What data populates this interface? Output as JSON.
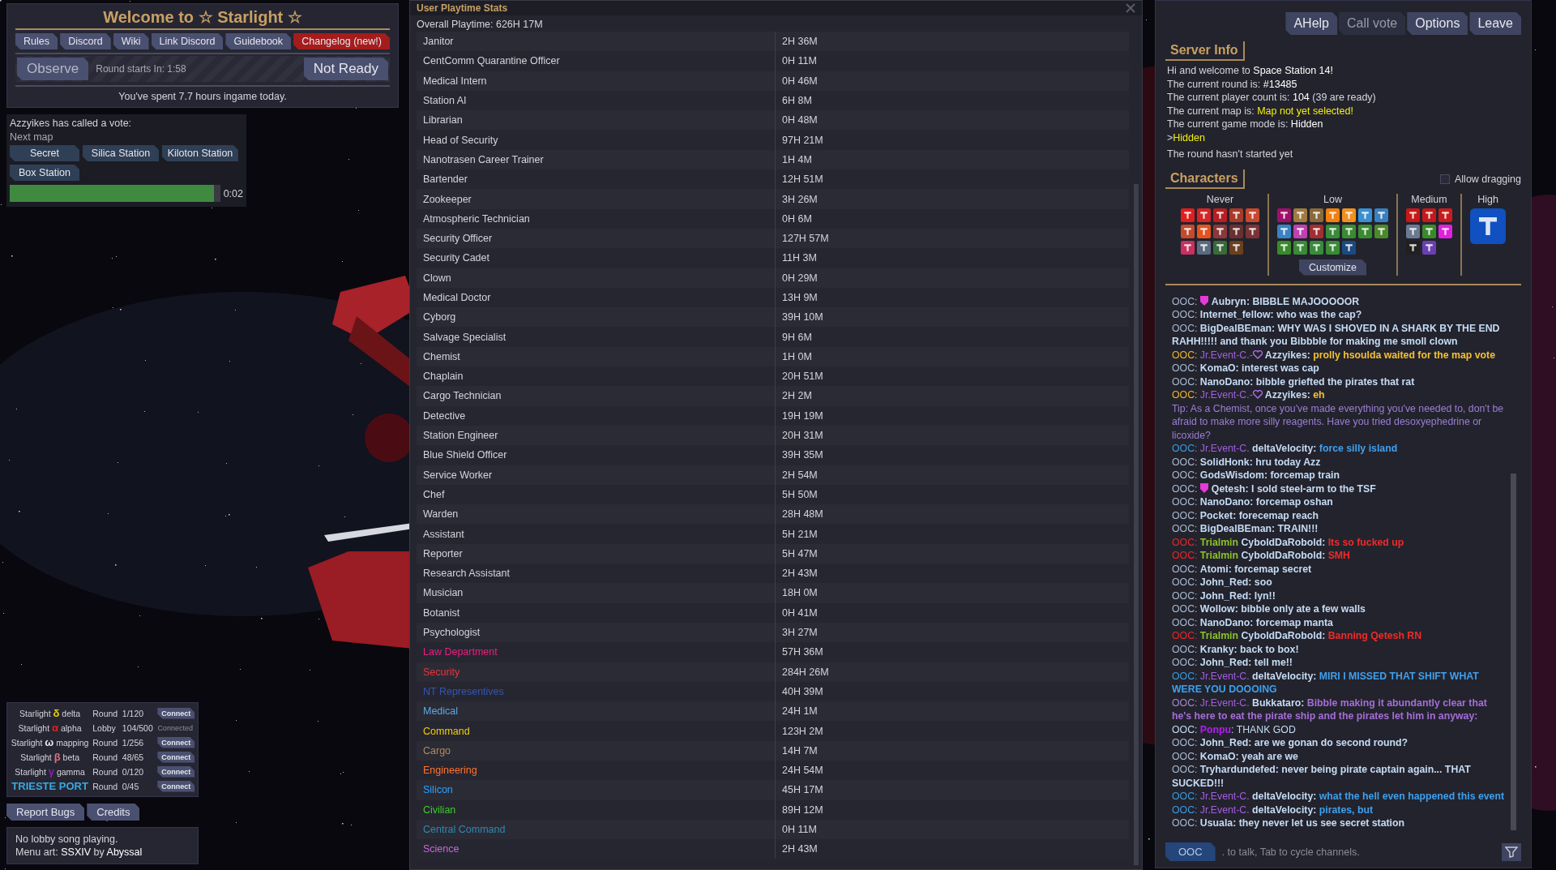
{
  "lobby": {
    "title": "Welcome to ☆ Starlight ☆",
    "links": [
      {
        "label": "Rules",
        "highlight": false
      },
      {
        "label": "Discord",
        "highlight": false
      },
      {
        "label": "Wiki",
        "highlight": false
      },
      {
        "label": "Link Discord",
        "highlight": false
      },
      {
        "label": "Guidebook",
        "highlight": false
      },
      {
        "label": "Changelog (new!)",
        "highlight": true
      }
    ],
    "observe": "Observe",
    "countdown": "Round starts In: 1:58",
    "ready": "Not Ready",
    "playtime_note": "You've spent 7.7 hours ingame today."
  },
  "vote": {
    "title": "Azzyikes has called a vote:",
    "subtitle": "Next map",
    "options": [
      "Secret",
      "Silica Station",
      "Kiloton Station",
      "Box Station"
    ],
    "level": 0.97,
    "timer": "0:02"
  },
  "servers": [
    {
      "name": [
        {
          "text": "Starlight "
        },
        {
          "text": "δ",
          "color": "#e6d200"
        },
        {
          "text": " delta"
        }
      ],
      "status": "Round",
      "players": "1/120",
      "action": "Connect",
      "connected": false
    },
    {
      "name": [
        {
          "text": "Starlight "
        },
        {
          "text": "α",
          "color": "#e02020"
        },
        {
          "text": " alpha"
        }
      ],
      "status": "Lobby",
      "players": "104/500",
      "action": "Connected",
      "connected": true
    },
    {
      "name": [
        {
          "text": "Starlight "
        },
        {
          "text": "ω",
          "color": "#e8e8f0"
        },
        {
          "text": " mapping"
        }
      ],
      "status": "Round",
      "players": "1/256",
      "action": "Connect",
      "connected": false
    },
    {
      "name": [
        {
          "text": "Starlight "
        },
        {
          "text": "β",
          "color": "#e07080"
        },
        {
          "text": " beta"
        }
      ],
      "status": "Round",
      "players": "48/65",
      "action": "Connect",
      "connected": false
    },
    {
      "name": [
        {
          "text": "Starlight "
        },
        {
          "text": "γ",
          "color": "#8a20b0"
        },
        {
          "text": " gamma"
        }
      ],
      "status": "Round",
      "players": "0/120",
      "action": "Connect",
      "connected": false
    },
    {
      "name": [
        {
          "text": "TRIESTE PORT",
          "color": "#3aa8e0"
        }
      ],
      "status": "Round",
      "players": "0/45",
      "action": "Connect",
      "connected": false
    }
  ],
  "bottom_buttons": [
    "Report Bugs",
    "Credits"
  ],
  "lobby_info": [
    [
      {
        "text": "No lobby song playing."
      }
    ],
    [
      {
        "text": "Menu art: "
      },
      {
        "text": "SSXIV",
        "color": "#ffffff"
      },
      {
        "text": " by "
      },
      {
        "text": "Abyssal",
        "color": "#ffffff"
      }
    ]
  ],
  "playtime": {
    "title": "User Playtime Stats",
    "overall": "Overall Playtime: 626H 17M",
    "rows": [
      {
        "job": "Janitor",
        "time": "2H 36M"
      },
      {
        "job": "CentComm Quarantine Officer",
        "time": "0H 11M"
      },
      {
        "job": "Medical Intern",
        "time": "0H 46M"
      },
      {
        "job": "Station AI",
        "time": "6H 8M"
      },
      {
        "job": "Librarian",
        "time": "0H 48M"
      },
      {
        "job": "Head of Security",
        "time": "97H 21M"
      },
      {
        "job": "Nanotrasen Career Trainer",
        "time": "1H 4M"
      },
      {
        "job": "Bartender",
        "time": "12H 51M"
      },
      {
        "job": "Zookeeper",
        "time": "3H 26M"
      },
      {
        "job": "Atmospheric Technician",
        "time": "0H 6M"
      },
      {
        "job": "Security Officer",
        "time": "127H 57M"
      },
      {
        "job": "Security Cadet",
        "time": "11H 3M"
      },
      {
        "job": "Clown",
        "time": "0H 29M"
      },
      {
        "job": "Medical Doctor",
        "time": "13H 9M"
      },
      {
        "job": "Cyborg",
        "time": "39H 10M"
      },
      {
        "job": "Salvage Specialist",
        "time": "9H 6M"
      },
      {
        "job": "Chemist",
        "time": "1H 0M"
      },
      {
        "job": "Chaplain",
        "time": "20H 51M"
      },
      {
        "job": "Cargo Technician",
        "time": "2H 2M"
      },
      {
        "job": "Detective",
        "time": "19H 19M"
      },
      {
        "job": "Station Engineer",
        "time": "20H 31M"
      },
      {
        "job": "Blue Shield Officer",
        "time": "39H 35M"
      },
      {
        "job": "Service Worker",
        "time": "2H 54M"
      },
      {
        "job": "Chef",
        "time": "5H 50M"
      },
      {
        "job": "Warden",
        "time": "28H 48M"
      },
      {
        "job": "Assistant",
        "time": "5H 21M"
      },
      {
        "job": "Reporter",
        "time": "5H 47M"
      },
      {
        "job": "Research Assistant",
        "time": "2H 43M"
      },
      {
        "job": "Musician",
        "time": "18H 0M"
      },
      {
        "job": "Botanist",
        "time": "0H 41M"
      },
      {
        "job": "Psychologist",
        "time": "3H 27M"
      },
      {
        "job": "Law Department",
        "time": "57H 36M",
        "color": "#e8207e"
      },
      {
        "job": "Security",
        "time": "284H 26M",
        "color": "#e8353a"
      },
      {
        "job": "NT Representives",
        "time": "40H 39M",
        "color": "#3555b4"
      },
      {
        "job": "Medical",
        "time": "24H 1M",
        "color": "#5aaae8"
      },
      {
        "job": "Command",
        "time": "123H 2M",
        "color": "#f0d000"
      },
      {
        "job": "Cargo",
        "time": "14H 7M",
        "color": "#b08a5c"
      },
      {
        "job": "Engineering",
        "time": "24H 54M",
        "color": "#ff7430"
      },
      {
        "job": "Silicon",
        "time": "45H 17M",
        "color": "#2aa2ff"
      },
      {
        "job": "Civilian",
        "time": "89H 12M",
        "color": "#3ccc2a"
      },
      {
        "job": "Central Command",
        "time": "0H 11M",
        "color": "#3088b0"
      },
      {
        "job": "Science",
        "time": "2H 43M",
        "color": "#c46ad6"
      }
    ]
  },
  "menu": {
    "buttons": [
      {
        "label": "AHelp",
        "disabled": false
      },
      {
        "label": "Call vote",
        "disabled": true
      },
      {
        "label": "Options",
        "disabled": false
      },
      {
        "label": "Leave",
        "disabled": false
      }
    ]
  },
  "server_info": {
    "heading": "Server Info",
    "lines": [
      [
        {
          "text": "Hi and welcome to "
        },
        {
          "text": "Space Station 14!",
          "color": "#ffffff"
        }
      ],
      [
        {
          "text": "The current round is: "
        },
        {
          "text": "#13485",
          "color": "#ffffff"
        }
      ],
      [
        {
          "text": "The current player count is: "
        },
        {
          "text": "104",
          "color": "#ffffff"
        },
        {
          "text": " (39 are ready)"
        }
      ],
      [
        {
          "text": "The current map is: "
        },
        {
          "text": "Map not yet selected!",
          "color": "#f2ee10"
        }
      ],
      [
        {
          "text": "The current game mode is: "
        },
        {
          "text": "Hidden",
          "color": "#ffffff"
        }
      ],
      [
        {
          "text": ">"
        },
        {
          "text": "Hidden",
          "color": "#f2ee10"
        }
      ],
      [
        {
          "text": "The round hasn't started yet"
        }
      ]
    ]
  },
  "characters": {
    "heading": "Characters",
    "allow_dragging": {
      "label": "Allow dragging",
      "checked": false
    },
    "customize": "Customize",
    "groups": [
      {
        "label": "Never",
        "jobs": [
          {
            "color": "#e01e1e"
          },
          {
            "color": "#d42626"
          },
          {
            "color": "#b81e22"
          },
          {
            "color": "#a83a28"
          },
          {
            "color": "#c8482e"
          },
          {
            "color": "#c44a2c"
          },
          {
            "color": "#e4531c"
          },
          {
            "color": "#8a3838"
          },
          {
            "color": "#6a3030"
          },
          {
            "color": "#7a3434"
          },
          {
            "color": "#c83060"
          },
          {
            "color": "#5a6a80"
          },
          {
            "color": "#3a6a3a"
          },
          {
            "color": "#6a4020"
          }
        ]
      },
      {
        "label": "Low",
        "jobs": [
          {
            "color": "#a0106a"
          },
          {
            "color": "#a07a40"
          },
          {
            "color": "#8a6a3a"
          },
          {
            "color": "#f08010"
          },
          {
            "color": "#f09020"
          },
          {
            "color": "#3a90d0"
          },
          {
            "color": "#3a80c0"
          },
          {
            "color": "#3a82c4"
          },
          {
            "color": "#c040b0"
          },
          {
            "color": "#a03030"
          },
          {
            "color": "#3a8a3a"
          },
          {
            "color": "#3a8a34"
          },
          {
            "color": "#3a8a30"
          },
          {
            "color": "#4a8a2a"
          },
          {
            "color": "#3a8a2a"
          },
          {
            "color": "#3a8a38"
          },
          {
            "color": "#3a8a3c"
          },
          {
            "color": "#3a8a36"
          },
          {
            "color": "#1a4a80"
          }
        ]
      },
      {
        "label": "Medium",
        "jobs": [
          {
            "color": "#c81818"
          },
          {
            "color": "#c41a1a"
          },
          {
            "color": "#c81c1c"
          },
          {
            "color": "#6a7a90"
          },
          {
            "color": "#3a8a2a"
          },
          {
            "color": "#e020e0"
          },
          {
            "color": "#202020"
          },
          {
            "color": "#6a40b0"
          }
        ]
      },
      {
        "label": "High",
        "jobs": [
          {
            "color": "#1050c0"
          }
        ]
      }
    ]
  },
  "chat": {
    "channel": "OOC",
    "placeholder": ". to talk, Tab to cycle channels.",
    "messages": [
      {
        "kind": "shield",
        "lead": [
          {
            "text": "OOC: ",
            "color": "#a9bad0"
          }
        ],
        "body": [
          {
            "text": "**Aubryn: BIBBLE MAJOOOOOR**",
            "color": "#c5dcf4"
          }
        ]
      },
      {
        "body": [
          {
            "text": "OOC: ",
            "color": "#a9bad0"
          },
          {
            "text": "**Internet_fellow: who was the cap?**",
            "color": "#c5dcf4"
          }
        ]
      },
      {
        "body": [
          {
            "text": "OOC: ",
            "color": "#a9bad0"
          },
          {
            "text": "**BigDealBEman: WHY WAS I SHOVED IN A SHARK BY THE END RAHH!!!!! and thank you Bibbble for making me smoll clown**",
            "color": "#c5dcf4"
          }
        ]
      },
      {
        "kind": "heart",
        "lead": [
          {
            "text": "OOC: ",
            "color": "#f0b428"
          },
          {
            "text": "Jr.Event-C.-",
            "color": "#a35ee0"
          }
        ],
        "body": [
          {
            "text": "**Azzyikes:** ",
            "color": "#c5dcf4"
          },
          {
            "text": "**prolly hsoulda waited for the map vote**",
            "color": "#f5c030"
          }
        ]
      },
      {
        "body": [
          {
            "text": "OOC: ",
            "color": "#a9bad0"
          },
          {
            "text": "**KomaO: interest was cap**",
            "color": "#c5dcf4"
          }
        ]
      },
      {
        "body": [
          {
            "text": "OOC: ",
            "color": "#a9bad0"
          },
          {
            "text": "**NanoDano: bibble griefted the pirates that rat**",
            "color": "#c5dcf4"
          }
        ]
      },
      {
        "kind": "heart",
        "lead": [
          {
            "text": "OOC: ",
            "color": "#f0b428"
          },
          {
            "text": "Jr.Event-C.-",
            "color": "#a35ee0"
          }
        ],
        "body": [
          {
            "text": "**Azzyikes:** ",
            "color": "#c5dcf4"
          },
          {
            "text": "**eh**",
            "color": "#f5c030"
          }
        ]
      },
      {
        "body": [
          {
            "text": "Tip: As a Chemist, once you've made everything you've needed to, don't be afraid to make more silly reagents. Have you tried desoxyephedrine or licoxide?",
            "color": "#9a7fd2"
          }
        ]
      },
      {
        "body": [
          {
            "text": "OOC: ",
            "color": "#3a9be0"
          },
          {
            "text": "Jr.Event-C.",
            "color": "#a35ee0"
          },
          {
            "text": " **deltaVelocity:** ",
            "color": "#c5dcf4"
          },
          {
            "text": "**force silly island**",
            "color": "#3ea0ee"
          }
        ]
      },
      {
        "body": [
          {
            "text": "OOC: ",
            "color": "#a9bad0"
          },
          {
            "text": "**SolidHonk: hru today Azz**",
            "color": "#c5dcf4"
          }
        ]
      },
      {
        "body": [
          {
            "text": "OOC: ",
            "color": "#a9bad0"
          },
          {
            "text": "**GodsWisdom: forcemap train**",
            "color": "#c5dcf4"
          }
        ]
      },
      {
        "kind": "shield",
        "lead": [
          {
            "text": "OOC: ",
            "color": "#a9bad0"
          }
        ],
        "body": [
          {
            "text": "**Qetesh: I sold steel-arm to the TSF**",
            "color": "#c5dcf4"
          }
        ]
      },
      {
        "body": [
          {
            "text": "OOC: ",
            "color": "#a9bad0"
          },
          {
            "text": "**NanoDano: forcemap oshan**",
            "color": "#c5dcf4"
          }
        ]
      },
      {
        "body": [
          {
            "text": "OOC: ",
            "color": "#a9bad0"
          },
          {
            "text": "**Pocket: forecemap reach**",
            "color": "#c5dcf4"
          }
        ]
      },
      {
        "body": [
          {
            "text": "OOC: ",
            "color": "#a9bad0"
          },
          {
            "text": "**BigDealBEman: TRAIN!!!**",
            "color": "#c5dcf4"
          }
        ]
      },
      {
        "body": [
          {
            "text": "OOC: ",
            "color": "#e82828"
          },
          {
            "text": "**Trialmin**",
            "color": "#8cc22a"
          },
          {
            "text": " **CyboldDaRobold:** ",
            "color": "#c5dcf4"
          },
          {
            "text": "**Its so fucked up**",
            "color": "#f02a2a"
          }
        ]
      },
      {
        "body": [
          {
            "text": "OOC: ",
            "color": "#e82828"
          },
          {
            "text": "**Trialmin**",
            "color": "#8cc22a"
          },
          {
            "text": " **CyboldDaRobold:** ",
            "color": "#c5dcf4"
          },
          {
            "text": "**SMH**",
            "color": "#f02a2a"
          }
        ]
      },
      {
        "body": [
          {
            "text": "OOC: ",
            "color": "#a9bad0"
          },
          {
            "text": "**Atomi: forcemap secret**",
            "color": "#c5dcf4"
          }
        ]
      },
      {
        "body": [
          {
            "text": "OOC: ",
            "color": "#a9bad0"
          },
          {
            "text": "**John_Red: soo**",
            "color": "#c5dcf4"
          }
        ]
      },
      {
        "body": [
          {
            "text": "OOC: ",
            "color": "#a9bad0"
          },
          {
            "text": "**John_Red: lyn!!**",
            "color": "#c5dcf4"
          }
        ]
      },
      {
        "body": [
          {
            "text": "OOC: ",
            "color": "#a9bad0"
          },
          {
            "text": "**Wollow: bibble only ate a few walls**",
            "color": "#c5dcf4"
          }
        ]
      },
      {
        "body": [
          {
            "text": "OOC: ",
            "color": "#a9bad0"
          },
          {
            "text": "**NanoDano: forcemap manta**",
            "color": "#c5dcf4"
          }
        ]
      },
      {
        "body": [
          {
            "text": "OOC: ",
            "color": "#e82828"
          },
          {
            "text": "**Trialmin**",
            "color": "#8cc22a"
          },
          {
            "text": " **CyboldDaRobold:** ",
            "color": "#c5dcf4"
          },
          {
            "text": "**Banning Qetesh RN**",
            "color": "#f02a2a"
          }
        ]
      },
      {
        "body": [
          {
            "text": "OOC: ",
            "color": "#a9bad0"
          },
          {
            "text": "**Kranky: back to box!**",
            "color": "#c5dcf4"
          }
        ]
      },
      {
        "body": [
          {
            "text": "OOC: ",
            "color": "#a9bad0"
          },
          {
            "text": "**John_Red: tell me!!**",
            "color": "#c5dcf4"
          }
        ]
      },
      {
        "body": [
          {
            "text": "OOC: ",
            "color": "#3a9be0"
          },
          {
            "text": "Jr.Event-C.",
            "color": "#a35ee0"
          },
          {
            "text": " **deltaVelocity:** ",
            "color": "#c5dcf4"
          },
          {
            "text": "**MIRI I MISSED THAT SHIFT WHAT WERE YOU DOOOING**",
            "color": "#3ea0ee"
          }
        ]
      },
      {
        "body": [
          {
            "text": "OOC: ",
            "color": "#a58ad0"
          },
          {
            "text": "Jr.Event-C.",
            "color": "#a35ee0"
          },
          {
            "text": " **Bukkataro:** ",
            "color": "#c5dcf4"
          },
          {
            "text": "**Bibble making it abundantly clear that he's here to eat the pirate ship and the pirates let him in anyway:**",
            "color": "#a46ed6"
          }
        ]
      },
      {
        "body": [
          {
            "text": "OOC: ",
            "color": "#c5dcf4"
          },
          {
            "text": "**Ponpu**",
            "color": "#b21ef0"
          },
          {
            "text": ": THANK GOD",
            "color": "#c5dcf4"
          }
        ]
      },
      {
        "body": [
          {
            "text": "OOC: ",
            "color": "#a9bad0"
          },
          {
            "text": "**John_Red: are we gonan do second round?**",
            "color": "#c5dcf4"
          }
        ]
      },
      {
        "body": [
          {
            "text": "OOC: ",
            "color": "#a9bad0"
          },
          {
            "text": "**KomaO: yeah are we**",
            "color": "#c5dcf4"
          }
        ]
      },
      {
        "body": [
          {
            "text": "OOC: ",
            "color": "#a9bad0"
          },
          {
            "text": "**Tryhardundefed: never being pirate captain again... THAT SUCKED!!!**",
            "color": "#c5dcf4"
          }
        ]
      },
      {
        "body": [
          {
            "text": "OOC: ",
            "color": "#3a9be0"
          },
          {
            "text": "Jr.Event-C.",
            "color": "#a35ee0"
          },
          {
            "text": " **deltaVelocity:** ",
            "color": "#c5dcf4"
          },
          {
            "text": "**what the hell even happened this event**",
            "color": "#3ea0ee"
          }
        ]
      },
      {
        "body": [
          {
            "text": "OOC: ",
            "color": "#3a9be0"
          },
          {
            "text": "Jr.Event-C.",
            "color": "#a35ee0"
          },
          {
            "text": " **deltaVelocity:** ",
            "color": "#c5dcf4"
          },
          {
            "text": "**pirates, but**",
            "color": "#3ea0ee"
          }
        ]
      },
      {
        "body": [
          {
            "text": "OOC: ",
            "color": "#a9bad0"
          },
          {
            "text": "**Usuala: they never let us see secret station**",
            "color": "#c5dcf4"
          }
        ]
      }
    ]
  }
}
